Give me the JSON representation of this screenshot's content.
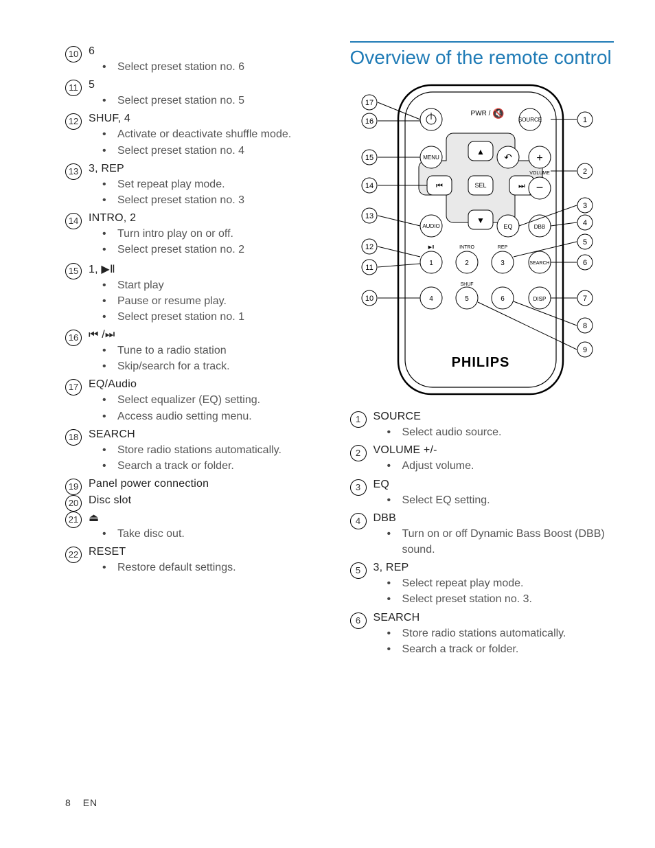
{
  "page_number": "8",
  "lang_code": "EN",
  "section_title_right": "Overview of the remote control",
  "remote": {
    "brand": "PHILIPS",
    "top_label": "PWR /",
    "volume_label": "VOLUME",
    "buttons": {
      "source": "SOURCE",
      "menu": "MENU",
      "sel": "SEL",
      "audio": "AUDIO",
      "eq": "EQ",
      "dbb": "DBB",
      "search": "SEARCH",
      "disp": "DISP",
      "n1": "1",
      "n2": "2",
      "n3": "3",
      "n4": "4",
      "n5": "5",
      "n6": "6",
      "intro": "INTRO",
      "rep": "REP",
      "shuf": "SHUF"
    },
    "callouts_left": [
      "17",
      "16",
      "15",
      "14",
      "13",
      "12",
      "11",
      "10"
    ],
    "callouts_right": [
      "1",
      "2",
      "3",
      "4",
      "5",
      "6",
      "7",
      "8",
      "9"
    ]
  },
  "left_items": [
    {
      "n": "10",
      "title": "6",
      "pts": [
        "Select preset station no. 6"
      ]
    },
    {
      "n": "11",
      "title": "5",
      "pts": [
        "Select preset station no. 5"
      ]
    },
    {
      "n": "12",
      "title": "SHUF, 4",
      "pts": [
        "Activate or deactivate shuffle mode.",
        "Select preset station no. 4"
      ]
    },
    {
      "n": "13",
      "title": "3, REP",
      "pts": [
        "Set repeat play mode.",
        "Select preset station no. 3"
      ]
    },
    {
      "n": "14",
      "title": "INTRO, 2",
      "pts": [
        "Turn intro play on or off.",
        "Select preset station no. 2"
      ]
    },
    {
      "n": "15",
      "title": "1, ",
      "glyph": "▶Ⅱ",
      "pts": [
        "Start play",
        "Pause or resume play.",
        "Select preset station no. 1"
      ]
    },
    {
      "n": "16",
      "title": "",
      "glyph": "⏮ /⏭",
      "pts": [
        "Tune to a radio station",
        "Skip/search for a track."
      ]
    },
    {
      "n": "17",
      "title": "EQ/Audio",
      "pts": [
        "Select equalizer (EQ) setting.",
        "Access audio setting menu."
      ]
    },
    {
      "n": "18",
      "title": "SEARCH",
      "pts": [
        "Store radio stations automatically.",
        "Search a track or folder."
      ]
    },
    {
      "n": "19",
      "title": "Panel power connection",
      "pts": []
    },
    {
      "n": "20",
      "title": "Disc slot",
      "pts": []
    },
    {
      "n": "21",
      "title": "",
      "glyph": "⏏",
      "pts": [
        "Take disc out."
      ]
    },
    {
      "n": "22",
      "title": "RESET",
      "pts": [
        "Restore default settings."
      ]
    }
  ],
  "right_items": [
    {
      "n": "1",
      "title": "SOURCE",
      "pts": [
        "Select audio source."
      ]
    },
    {
      "n": "2",
      "title": "VOLUME +/-",
      "pts": [
        "Adjust volume."
      ]
    },
    {
      "n": "3",
      "title": "EQ",
      "pts": [
        "Select EQ setting."
      ]
    },
    {
      "n": "4",
      "title": "DBB",
      "pts": [
        "Turn on or off Dynamic Bass Boost (DBB) sound."
      ]
    },
    {
      "n": "5",
      "title": "3, REP",
      "pts": [
        "Select repeat play mode.",
        "Select preset station no. 3."
      ]
    },
    {
      "n": "6",
      "title": "SEARCH",
      "pts": [
        "Store radio stations automatically.",
        "Search a track or folder."
      ]
    }
  ]
}
